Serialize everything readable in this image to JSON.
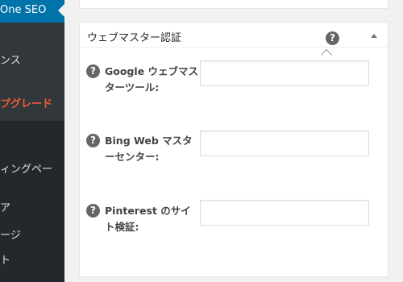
{
  "sidebar": {
    "active_label": "One SEO",
    "items": [
      {
        "label": "ンス"
      },
      {
        "label": "プグレード"
      },
      {
        "label": "ィングペー"
      },
      {
        "label": "ア"
      },
      {
        "label": "ージ"
      },
      {
        "label": "ト"
      }
    ]
  },
  "metabox": {
    "title": "ウェブマスター認証",
    "help_icon": "?",
    "toggle_icon": "collapse-arrow",
    "fields": [
      {
        "label": "Google ウェブマスターツール:",
        "value": "",
        "help_icon": "?"
      },
      {
        "label": "Bing Web マスターセンター:",
        "value": "",
        "help_icon": "?"
      },
      {
        "label": "Pinterest のサイト検証:",
        "value": "",
        "help_icon": "?"
      }
    ]
  },
  "colors": {
    "sidebar_bg": "#23282d",
    "submenu_bg": "#32373c",
    "active_bg": "#0073aa",
    "upgrade_text": "#f25b37"
  }
}
